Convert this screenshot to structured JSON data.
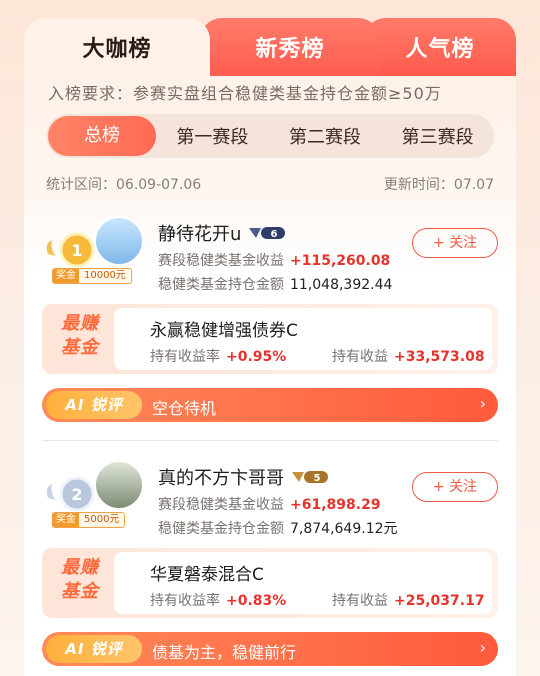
{
  "tabs": [
    "大咖榜",
    "新秀榜",
    "人气榜"
  ],
  "requirement": "入榜要求：参赛实盘组合稳健类基金持仓金额≥50万",
  "segments": [
    "总榜",
    "第一赛段",
    "第二赛段",
    "第三赛段"
  ],
  "stat_range": "统计区间：06.09-07.06",
  "update_time": "更新时间：07.07",
  "entries": [
    {
      "rank": "1",
      "prize_label": "奖金",
      "prize": "10000元",
      "name": "静待花开u",
      "level": "6",
      "label1": "赛段稳健类基金收益",
      "value1": "+115,260.08",
      "label2": "稳健类基金持仓金额",
      "value2": "11,048,392.44",
      "follow": "+ 关注",
      "fund_tag": "最赚\n基金",
      "fund_name": "永赢稳健增强债券C",
      "rate_label": "持有收益率",
      "rate": "+0.95%",
      "gain_label": "持有收益",
      "gain": "+33,573.08",
      "ai_label": "AI 锐评",
      "ai_text": "空仓待机"
    },
    {
      "rank": "2",
      "prize_label": "奖金",
      "prize": "5000元",
      "name": "真的不方卞哥哥",
      "level": "5",
      "label1": "赛段稳健类基金收益",
      "value1": "+61,898.29",
      "label2": "稳健类基金持仓金额",
      "value2": "7,874,649.12元",
      "follow": "+ 关注",
      "fund_tag": "最赚\n基金",
      "fund_name": "华夏磐泰混合C",
      "rate_label": "持有收益率",
      "rate": "+0.83%",
      "gain_label": "持有收益",
      "gain": "+25,037.17",
      "ai_label": "AI 锐评",
      "ai_text": "债基为主，稳健前行"
    }
  ],
  "colors": {
    "accent": "#ff5d4f",
    "red": "#e5342d",
    "gold": "#f39a2c"
  },
  "icons": [
    "medal-gold-icon",
    "medal-silver-icon",
    "level-badge-icon",
    "chevron-right-icon"
  ]
}
